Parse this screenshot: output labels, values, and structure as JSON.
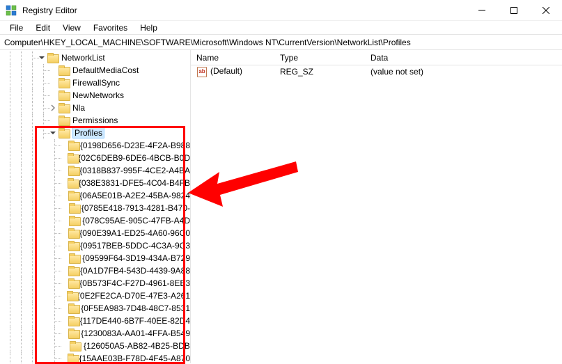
{
  "window": {
    "title": "Registry Editor"
  },
  "menu": {
    "items": [
      "File",
      "Edit",
      "View",
      "Favorites",
      "Help"
    ]
  },
  "address": {
    "path": "Computer\\HKEY_LOCAL_MACHINE\\SOFTWARE\\Microsoft\\Windows NT\\CurrentVersion\\NetworkList\\Profiles"
  },
  "tree": {
    "networklist": {
      "label": "NetworkList",
      "children": [
        {
          "label": "DefaultMediaCost"
        },
        {
          "label": "FirewallSync"
        },
        {
          "label": "NewNetworks"
        },
        {
          "label": "Nla",
          "expandable": true
        },
        {
          "label": "Permissions"
        }
      ]
    },
    "profiles": {
      "label": "Profiles",
      "children": [
        "{0198D656-D23E-4F2A-B988",
        "{02C6DEB9-6DE6-4BCB-B0D",
        "{0318B837-995F-4CE2-A4BA",
        "{038E3831-DFE5-4C04-B4FB",
        "{06A5E01B-A2E2-45BA-9824",
        "{0785E418-7913-4281-B470-",
        "{078C95AE-905C-47FB-A4D",
        "{090E39A1-ED25-4A60-96C0",
        "{09517BEB-5DDC-4C3A-9C3",
        "{09599F64-3D19-434A-B729",
        "{0A1D7FB4-543D-4439-9A88",
        "{0B573F4C-F27D-4961-8EB3",
        "{0E2FE2CA-D70E-47E3-A261",
        "{0F5EA983-7D48-48C7-8531",
        "{117DE440-6B7F-40EE-82D4",
        "{1230083A-AA01-4FFA-B549",
        "{126050A5-AB82-4B25-BDB",
        "{15AAE03B-F78D-4F45-A870"
      ]
    }
  },
  "list": {
    "columns": {
      "name": "Name",
      "type": "Type",
      "data": "Data"
    },
    "rows": [
      {
        "name": "(Default)",
        "type": "REG_SZ",
        "data": "(value not set)"
      }
    ]
  }
}
